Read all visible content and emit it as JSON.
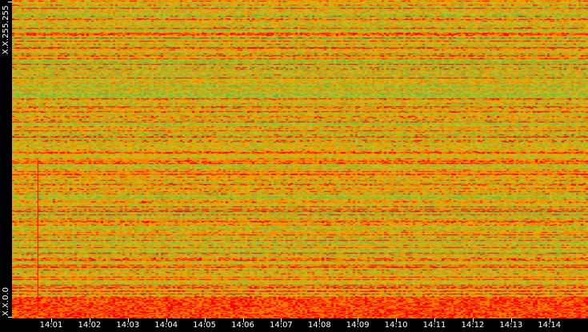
{
  "chart_data": {
    "type": "heatmap",
    "title": "",
    "xlabel": "",
    "ylabel": "",
    "x_ticks": [
      "14:01",
      "14:02",
      "14:03",
      "14:04",
      "14:05",
      "14:06",
      "14:07",
      "14:08",
      "14:09",
      "14:10",
      "14:11",
      "14:12",
      "14:13",
      "14:14"
    ],
    "y_ticks": [
      "X.X.255.255",
      "X.X.0.0"
    ],
    "colormap": {
      "low": "#6cb43c",
      "mid": "#f2a000",
      "high": "#ff0000"
    },
    "legend": "none",
    "grid": false
  }
}
